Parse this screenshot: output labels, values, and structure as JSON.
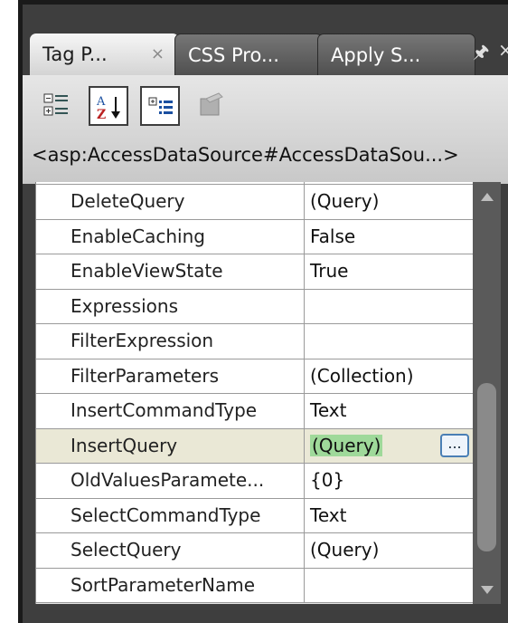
{
  "tabs": [
    {
      "label": "Tag P...",
      "close": "×",
      "active": true
    },
    {
      "label": "CSS Pro...",
      "active": false
    },
    {
      "label": "Apply S...",
      "active": false
    }
  ],
  "window_controls": {
    "pin": "📌",
    "close": "×"
  },
  "toolbar": {
    "buttons": [
      {
        "icon": "categorized-icon",
        "active": false
      },
      {
        "icon": "alphabetical-sort-icon",
        "active": true
      },
      {
        "icon": "show-set-properties-icon",
        "active": true
      },
      {
        "icon": "properties-page-icon",
        "active": false
      }
    ]
  },
  "selector": "<asp:AccessDataSource#AccessDataSou...>",
  "properties": [
    {
      "name": "DeleteQuery",
      "value": "(Query)"
    },
    {
      "name": "EnableCaching",
      "value": "False"
    },
    {
      "name": "EnableViewState",
      "value": "True"
    },
    {
      "name": "Expressions",
      "value": ""
    },
    {
      "name": "FilterExpression",
      "value": ""
    },
    {
      "name": "FilterParameters",
      "value": "(Collection)"
    },
    {
      "name": "InsertCommandType",
      "value": "Text"
    },
    {
      "name": "InsertQuery",
      "value": "(Query)",
      "selected": true
    },
    {
      "name": "OldValuesParamete...",
      "value": "{0}"
    },
    {
      "name": "SelectCommandType",
      "value": "Text"
    },
    {
      "name": "SelectQuery",
      "value": "(Query)"
    },
    {
      "name": "SortParameterName",
      "value": ""
    }
  ],
  "ellipsis_label": "...",
  "colors": {
    "selected_row": "#eae8d6",
    "selected_value": "#9fd99a",
    "panel": "#3e3e3e"
  }
}
